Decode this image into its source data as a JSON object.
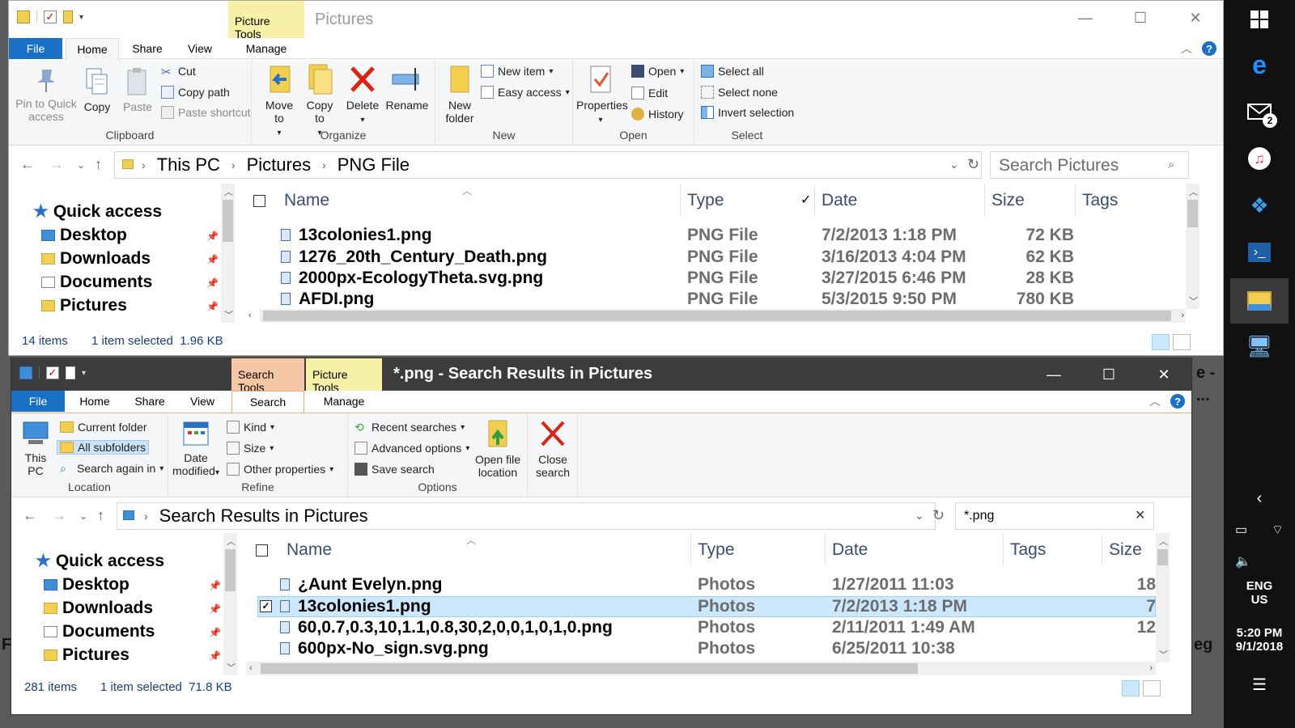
{
  "win1": {
    "context_tab": "Picture Tools",
    "title": "Pictures",
    "tabs": {
      "file": "File",
      "home": "Home",
      "share": "Share",
      "view": "View",
      "manage": "Manage"
    },
    "ribbon": {
      "pin": "Pin to Quick access",
      "copy": "Copy",
      "paste": "Paste",
      "cut": "Cut",
      "copy_path": "Copy path",
      "paste_shortcut": "Paste shortcut",
      "clipboard": "Clipboard",
      "move_to": "Move to",
      "copy_to": "Copy to",
      "delete": "Delete",
      "rename": "Rename",
      "organize": "Organize",
      "new_folder": "New folder",
      "new_item": "New item",
      "easy_access": "Easy access",
      "new_group": "New",
      "properties": "Properties",
      "open": "Open",
      "edit": "Edit",
      "history": "History",
      "open_group": "Open",
      "select_all": "Select all",
      "select_none": "Select none",
      "invert_selection": "Invert selection",
      "select_group": "Select"
    },
    "breadcrumb": [
      "This PC",
      "Pictures",
      "PNG File"
    ],
    "search_placeholder": "Search Pictures",
    "nav": {
      "quick_access": "Quick access",
      "items": [
        "Desktop",
        "Downloads",
        "Documents",
        "Pictures"
      ]
    },
    "columns": {
      "name": "Name",
      "type": "Type",
      "date": "Date",
      "size": "Size",
      "tags": "Tags"
    },
    "rows": [
      {
        "name": "13colonies1.png",
        "type": "PNG File",
        "date": "7/2/2013 1:18 PM",
        "size": "72 KB"
      },
      {
        "name": "1276_20th_Century_Death.png",
        "type": "PNG File",
        "date": "3/16/2013 4:04 PM",
        "size": "62 KB"
      },
      {
        "name": "2000px-EcologyTheta.svg.png",
        "type": "PNG File",
        "date": "3/27/2015 6:46 PM",
        "size": "28 KB"
      },
      {
        "name": "AFDI.png",
        "type": "PNG File",
        "date": "5/3/2015 9:50 PM",
        "size": "780 KB"
      }
    ],
    "status": {
      "count": "14 items",
      "selection": "1 item selected  1.96 KB"
    }
  },
  "win2": {
    "context_search": "Search Tools",
    "context_picture": "Picture Tools",
    "title": "*.png - Search Results in Pictures",
    "tabs": {
      "file": "File",
      "home": "Home",
      "share": "Share",
      "view": "View",
      "search": "Search",
      "manage": "Manage"
    },
    "ribbon": {
      "this_pc": "This PC",
      "current_folder": "Current folder",
      "all_subfolders": "All subfolders",
      "search_again": "Search again in",
      "location": "Location",
      "date_modified": "Date modified",
      "kind": "Kind",
      "size": "Size",
      "other_properties": "Other properties",
      "refine": "Refine",
      "recent_searches": "Recent searches",
      "advanced_options": "Advanced options",
      "save_search": "Save search",
      "open_file_location": "Open file location",
      "options": "Options",
      "close_search": "Close search"
    },
    "breadcrumb": "Search Results in Pictures",
    "search_value": "*.png",
    "nav": {
      "quick_access": "Quick access",
      "items": [
        "Desktop",
        "Downloads",
        "Documents",
        "Pictures"
      ]
    },
    "columns": {
      "name": "Name",
      "type": "Type",
      "date": "Date",
      "tags": "Tags",
      "size": "Size"
    },
    "rows": [
      {
        "name": "¿Aunt Evelyn.png",
        "type": "Photos",
        "date": "1/27/2011 11:03",
        "size": "18"
      },
      {
        "name": "13colonies1.png",
        "type": "Photos",
        "date": "7/2/2013 1:18 PM",
        "size": "7"
      },
      {
        "name": "60,0.7,0.3,10,1.1,0.8,30,2,0,0,1,0,1,0.png",
        "type": "Photos",
        "date": "2/11/2011 1:49 AM",
        "size": "12"
      },
      {
        "name": "600px-No_sign.svg.png",
        "type": "Photos",
        "date": "6/25/2011 10:38",
        "size": ""
      }
    ],
    "status": {
      "count": "281 items",
      "selection": "1 item selected  71.8 KB"
    }
  },
  "taskbar": {
    "lang1": "ENG",
    "lang2": "US",
    "time": "5:20 PM",
    "date": "9/1/2018",
    "mail_badge": "2"
  },
  "background": {
    "t1": "e -",
    "t2": "...",
    "t3": "F",
    "t4": "eg"
  }
}
